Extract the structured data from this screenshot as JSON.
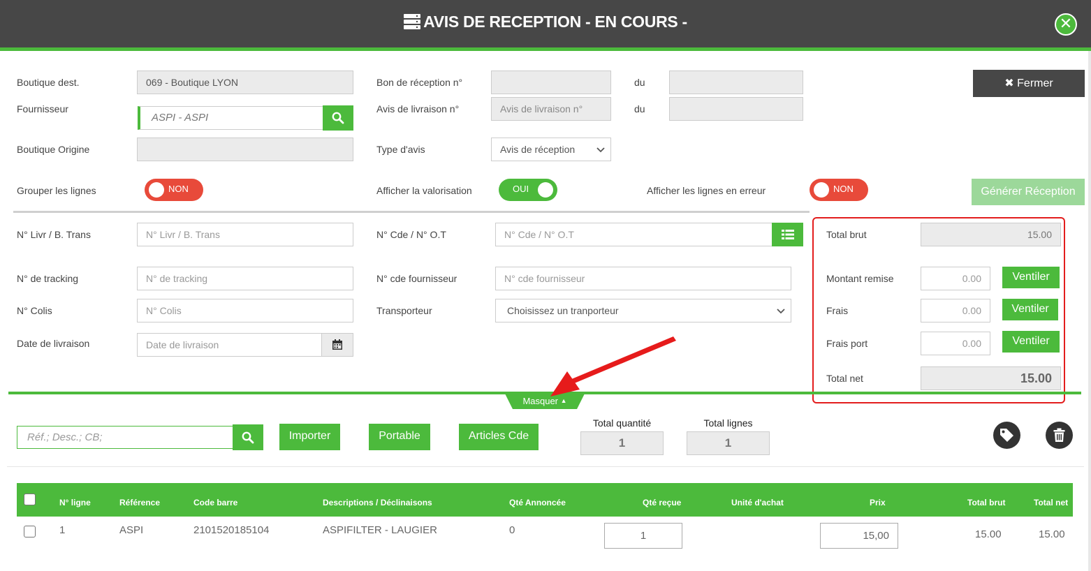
{
  "window": {
    "title": "AVIS DE RECEPTION - EN COURS -",
    "close_icon": "times-circle-icon",
    "title_icon": "server-icon"
  },
  "colors": {
    "accent": "#4cba3c",
    "header": "#474747",
    "toggle_off": "#e84a3a",
    "highlight": "#e31d1d"
  },
  "header_form": {
    "boutique_dest_label": "Boutique dest.",
    "boutique_dest_value": "069 - Boutique LYON",
    "fournisseur_label": "Fournisseur",
    "fournisseur_value": "ASPI - ASPI",
    "boutique_origine_label": "Boutique Origine",
    "boutique_origine_value": "",
    "bon_reception_label": "Bon de réception n°",
    "bon_reception_value": "",
    "avis_livraison_label": "Avis de livraison n°",
    "avis_livraison_placeholder": "Avis de livraison n°",
    "du_label": "du",
    "du_value_1": "",
    "du_value_2": "",
    "type_avis_label": "Type d'avis",
    "type_avis_value": "Avis de réception",
    "fermer_label": "Fermer"
  },
  "toggles": {
    "grouper_label": "Grouper les lignes",
    "grouper_state": "NON",
    "valorisation_label": "Afficher la valorisation",
    "valorisation_state": "OUI",
    "erreur_label": "Afficher les lignes en erreur",
    "erreur_state": "NON",
    "generer_label": "Générer Réception"
  },
  "details": {
    "livr_label": "N° Livr / B. Trans",
    "livr_placeholder": "N° Livr / B. Trans",
    "tracking_label": "N° de tracking",
    "tracking_placeholder": "N° de tracking",
    "colis_label": "N° Colis",
    "colis_placeholder": "N° Colis",
    "date_label": "Date de livraison",
    "date_placeholder": "Date de livraison",
    "cde_label": "N° Cde / N° O.T",
    "cde_placeholder": "N° Cde / N° O.T",
    "cde_fourn_label": "N° cde fournisseur",
    "cde_fourn_placeholder": "N° cde fournisseur",
    "transporteur_label": "Transporteur",
    "transporteur_value": "Choisissez un tranporteur"
  },
  "totals": {
    "brut_label": "Total brut",
    "brut_value": "15.00",
    "remise_label": "Montant remise",
    "remise_value": "0.00",
    "frais_label": "Frais",
    "frais_value": "0.00",
    "port_label": "Frais port",
    "port_value": "0.00",
    "net_label": "Total net",
    "net_value": "15.00",
    "ventiler_label": "Ventiler"
  },
  "masquer_label": "Masquer",
  "toolbar": {
    "search_placeholder": "Réf.; Desc.; CB;",
    "importer_label": "Importer",
    "portable_label": "Portable",
    "articles_label": "Articles Cde",
    "total_quantite_label": "Total quantité",
    "total_quantite_value": "1",
    "total_lignes_label": "Total lignes",
    "total_lignes_value": "1",
    "tag_icon": "tag-icon",
    "trash_icon": "trash-icon"
  },
  "table": {
    "columns": [
      "N° ligne",
      "Référence",
      "Code barre",
      "Descriptions / Déclinaisons",
      "Qté Annoncée",
      "Qté reçue",
      "Unité d'achat",
      "Prix",
      "Total brut",
      "Total net"
    ],
    "rows": [
      {
        "ligne": "1",
        "reference": "ASPI",
        "code_barre": "2101520185104",
        "description": "ASPIFILTER - LAUGIER",
        "qte_annoncee": "0",
        "qte_recue": "1",
        "unite": "",
        "prix": "15,00",
        "total_brut": "15.00",
        "total_net": "15.00"
      }
    ]
  }
}
